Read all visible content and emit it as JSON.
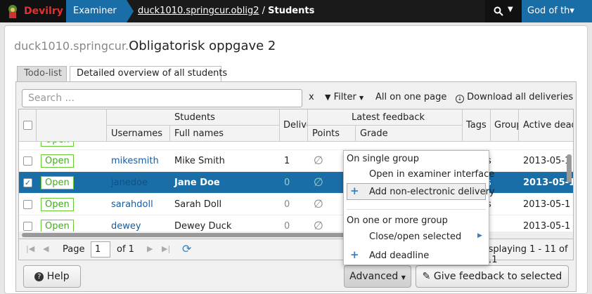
{
  "topbar": {
    "app_name": "Devilry",
    "role": "Examiner",
    "breadcrumb_link": "duck1010.springcur.oblig2",
    "breadcrumb_sep": "/",
    "breadcrumb_current": "Students",
    "user": "God of th▾"
  },
  "page": {
    "title_prefix": "duck1010.springcur.",
    "title": "Obligatorisk oppgave 2"
  },
  "tabs": [
    {
      "label": "Todo-list"
    },
    {
      "label": "Detailed overview of all students"
    }
  ],
  "toolbar": {
    "search_placeholder": "Search ...",
    "clear": "x",
    "filter": "Filter",
    "all_on_one_page": "All on one page",
    "download": "Download all deliveries"
  },
  "grid": {
    "headers": {
      "students": "Students",
      "usernames": "Usernames",
      "full_names": "Full names",
      "deliveries": "Deliver",
      "latest_feedback": "Latest feedback",
      "points": "Points",
      "grade": "Grade",
      "tags": "Tags",
      "group": "Group",
      "active_deadline": "Active dead"
    },
    "rows": [
      {
        "status": "Open",
        "username": "mikesmith",
        "fullname": "Mike Smith",
        "deliveries": "1",
        "tags": "s",
        "deadline": "2013-05-1",
        "selected": false
      },
      {
        "status": "Open",
        "username": "janedoe",
        "fullname": "Jane Doe",
        "deliveries": "0",
        "tags": "s",
        "deadline": "2013-05-1",
        "selected": true
      },
      {
        "status": "Open",
        "username": "sarahdoll",
        "fullname": "Sarah Doll",
        "deliveries": "0",
        "tags": "s",
        "deadline": "2013-05-1",
        "selected": false
      },
      {
        "status": "Open",
        "username": "dewey",
        "fullname": "Dewey Duck",
        "deliveries": "0",
        "tags": "",
        "deadline": "2013-05-1",
        "selected": false
      }
    ]
  },
  "pager": {
    "page_label": "Page",
    "page_value": "1",
    "of_label": "of 1",
    "displaying": "isplaying 1 - 11 of 11"
  },
  "buttons": {
    "help": "Help",
    "advanced": "Advanced",
    "give_feedback": "Give feedback to selected"
  },
  "menu": {
    "single_group_header": "On single group",
    "open_examiner": "Open in examiner interface",
    "add_non_electronic": "Add non-electronic delivery",
    "multi_group_header": "On one or more group",
    "close_open_selected": "Close/open selected",
    "add_deadline": "Add deadline"
  },
  "colors": {
    "accent": "#1a6ea8",
    "brand": "#dd3333",
    "open_badge": "#66cc33"
  }
}
